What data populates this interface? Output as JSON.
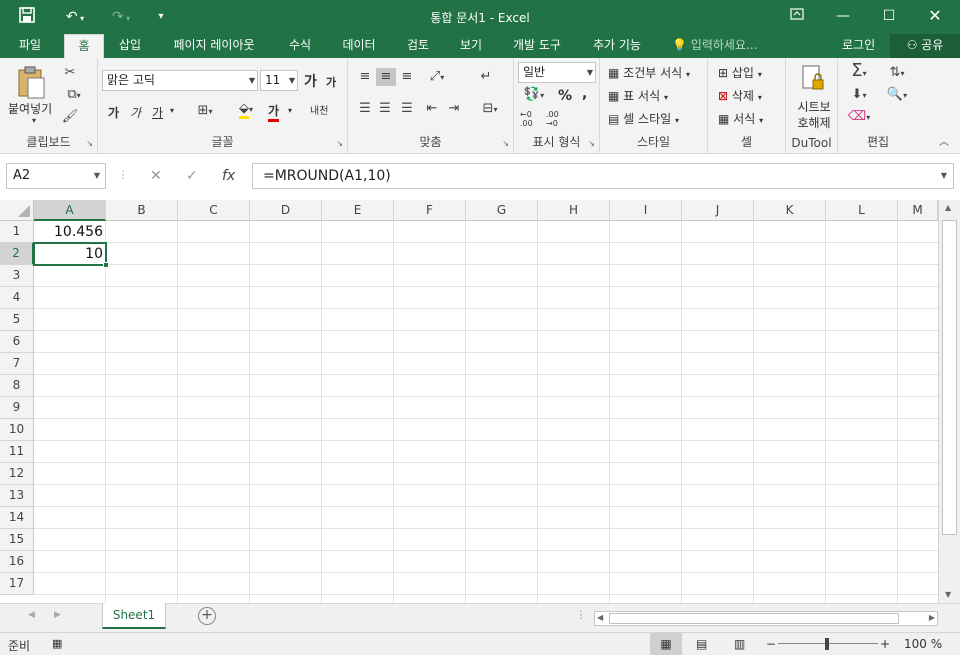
{
  "window": {
    "title": "통합 문서1 - Excel"
  },
  "quick_access": {
    "save_icon": "save-icon",
    "undo_icon": "undo-icon",
    "redo_icon": "redo-icon",
    "customize_icon": "customize-qat-icon"
  },
  "tabs": [
    "파일",
    "홈",
    "삽입",
    "페이지 레이아웃",
    "수식",
    "데이터",
    "검토",
    "보기",
    "개발 도구",
    "추가 기능"
  ],
  "active_tab": "홈",
  "tell_me": "입력하세요...",
  "account": {
    "login": "로그인",
    "share": "공유"
  },
  "ribbon": {
    "clipboard": {
      "label": "클립보드",
      "paste": "붙여넣기"
    },
    "font": {
      "label": "글꼴",
      "name": "맑은 고딕",
      "size": "11",
      "grow": "가",
      "shrink": "가",
      "bold": "가",
      "italic": "가",
      "underline": "가",
      "color_glyph": "가",
      "phonetic": "내천"
    },
    "alignment": {
      "label": "맞춤"
    },
    "number": {
      "label": "표시 형식",
      "format": "일반",
      "percent": "%",
      "comma": ",",
      "inc_decimal": "←0 .00",
      "dec_decimal": ".00 →0"
    },
    "styles": {
      "label": "스타일",
      "conditional": "조건부 서식",
      "table": "표 서식",
      "cell": "셀 스타일"
    },
    "cells": {
      "label": "셀",
      "insert": "삽입",
      "delete": "삭제",
      "format": "서식"
    },
    "dutool": {
      "label": "DuTool",
      "protect_line1": "시트보",
      "protect_line2": "호해제"
    },
    "editing": {
      "label": "편집"
    }
  },
  "formula_bar": {
    "name_box": "A2",
    "cancel": "✕",
    "enter": "✓",
    "fx": "fx",
    "formula": "=MROUND(A1,10)"
  },
  "columns": [
    "A",
    "B",
    "C",
    "D",
    "E",
    "F",
    "G",
    "H",
    "I",
    "J",
    "K",
    "L",
    "M"
  ],
  "rows": [
    "1",
    "2",
    "3",
    "4",
    "5",
    "6",
    "7",
    "8",
    "9",
    "10",
    "11",
    "12",
    "13",
    "14",
    "15",
    "16",
    "17"
  ],
  "cells": {
    "A1": "10.456",
    "A2": "10"
  },
  "selected_cell": "A2",
  "sheets": [
    "Sheet1"
  ],
  "status": {
    "ready": "준비",
    "zoom_minus": "−",
    "zoom_plus": "+",
    "zoom": "100 %"
  },
  "colors": {
    "accent": "#217346"
  }
}
